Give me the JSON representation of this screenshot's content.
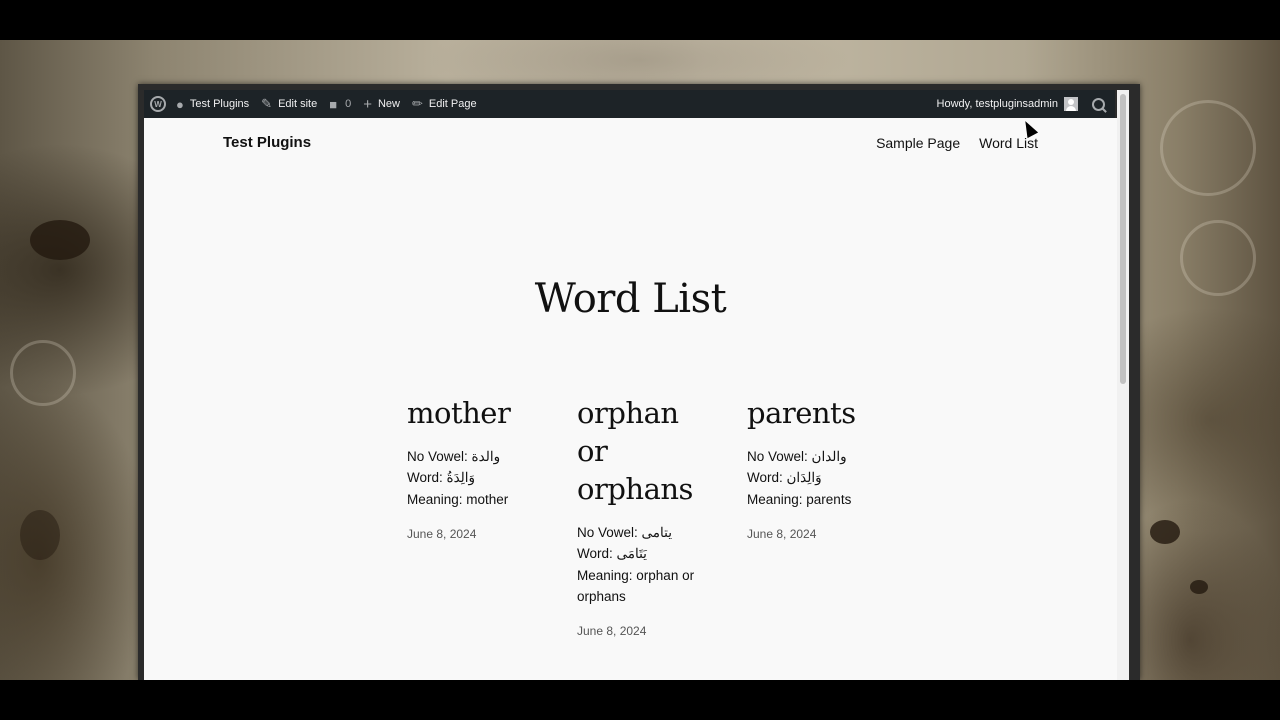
{
  "admin_bar": {
    "site_name": "Test Plugins",
    "edit_site": "Edit site",
    "comments_count": "0",
    "new_label": "New",
    "edit_page": "Edit Page",
    "howdy": "Howdy, testpluginsadmin"
  },
  "header": {
    "site_title": "Test Plugins",
    "nav": [
      "Sample Page",
      "Word List"
    ]
  },
  "main": {
    "title": "Word List",
    "posts": [
      {
        "title": "mother",
        "no_vowel": "No Vowel: والدة",
        "word": "Word: وَالِدَةُ",
        "meaning": "Meaning: mother",
        "date": "June 8, 2024"
      },
      {
        "title": "orphan or orphans",
        "no_vowel": "No Vowel: يتامى",
        "word": "Word: يَتَامَى",
        "meaning": "Meaning: orphan or orphans",
        "date": "June 8, 2024"
      },
      {
        "title": "parents",
        "no_vowel": "No Vowel: والدان",
        "word": "Word: وَالِدَان",
        "meaning": "Meaning: parents",
        "date": "June 8, 2024"
      }
    ]
  },
  "colors": {
    "admin_bar_bg": "#1d2327",
    "page_bg": "#f9f9f9",
    "text": "#111111"
  }
}
